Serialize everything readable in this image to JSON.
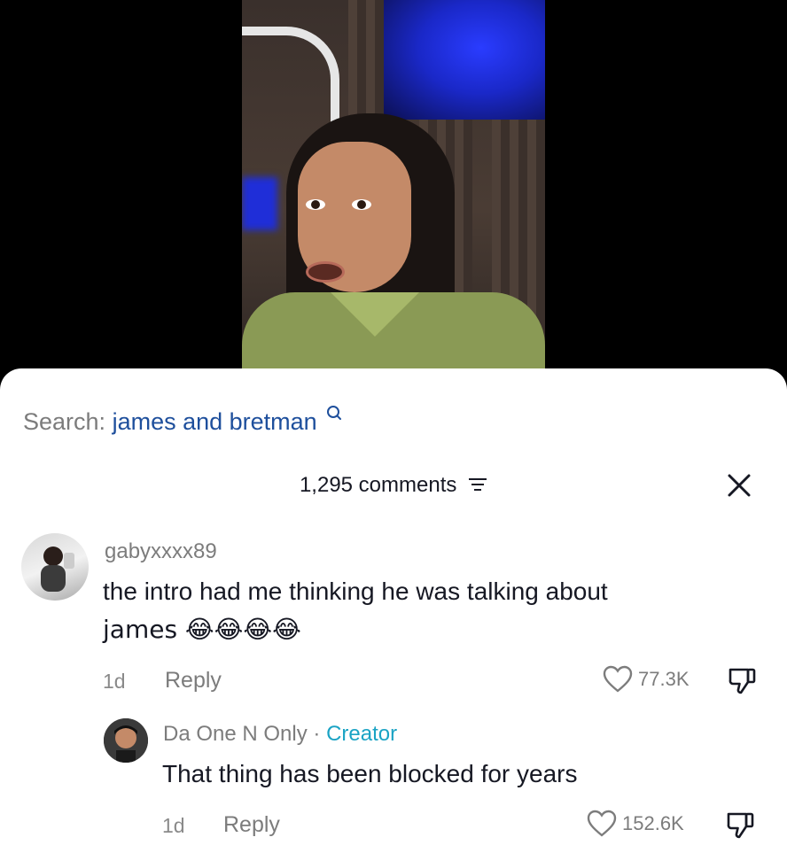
{
  "search": {
    "prefix": "Search:",
    "term": "james and bretman"
  },
  "comments_header": {
    "count_label": "1,295 comments"
  },
  "comments": [
    {
      "username": "gabyxxxx89",
      "text_line1": "the intro had me thinking he was talking about",
      "text_line2": "james 😂😂😂😂",
      "time": "1d",
      "reply_label": "Reply",
      "likes": "77.3K"
    }
  ],
  "replies": [
    {
      "username": "Da One N Only",
      "separator": " · ",
      "tag": "Creator",
      "text": "That thing has been blocked for years",
      "time": "1d",
      "reply_label": "Reply",
      "likes": "152.6K"
    }
  ],
  "colors": {
    "search_term": "#1e4f9c",
    "creator_tag": "#1aa3c4",
    "muted": "#7c7c7c"
  },
  "icons": [
    "search-icon",
    "filter-icon",
    "close-icon",
    "heart-icon",
    "dislike-icon"
  ]
}
